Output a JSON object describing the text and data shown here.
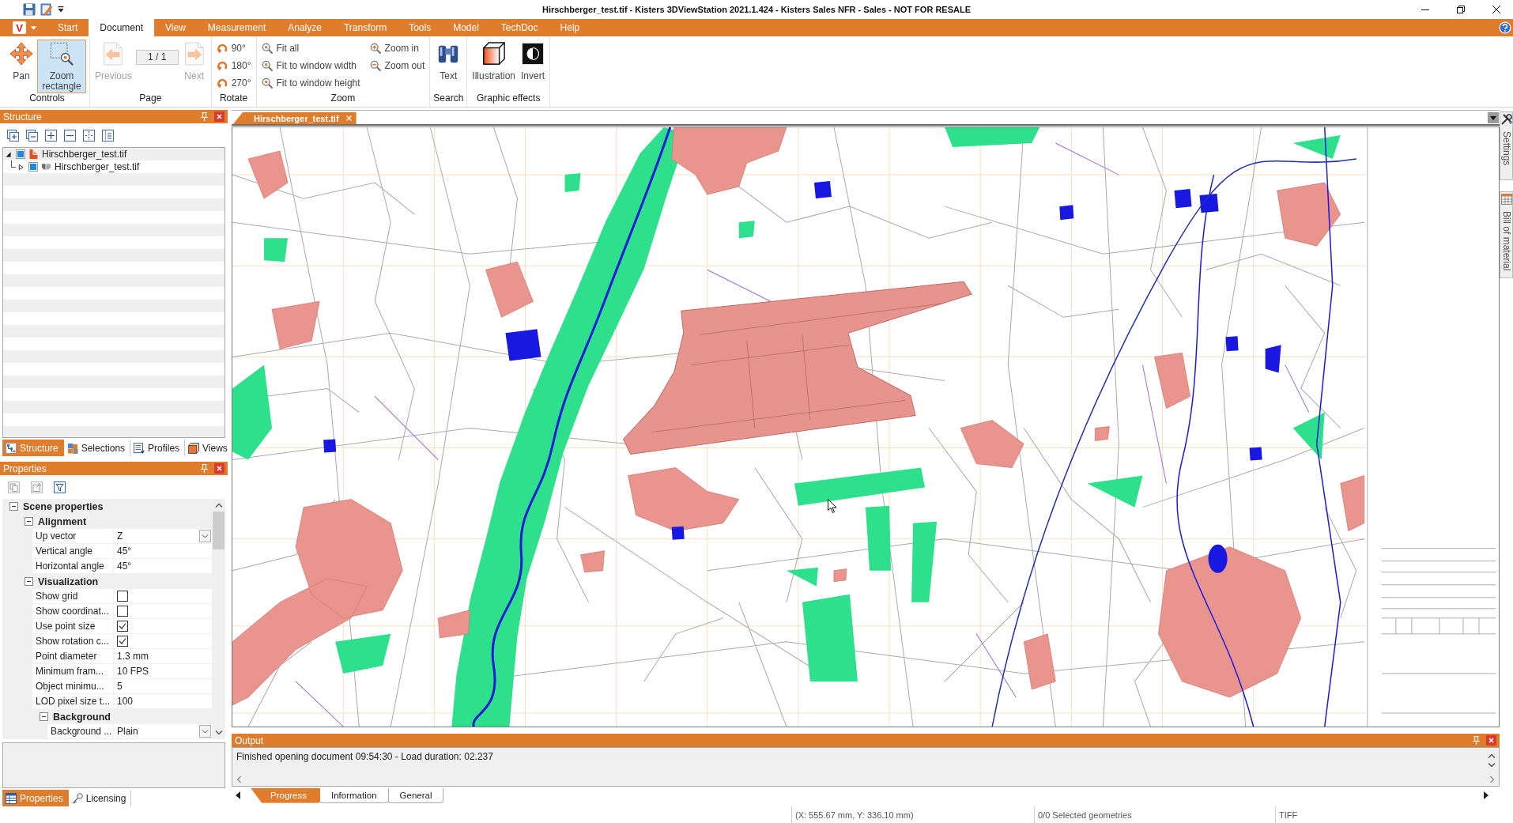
{
  "window": {
    "title": "Hirschberger_test.tif - Kisters 3DViewStation 2021.1.424 - Kisters Sales NFR - Sales - NOT FOR RESALE"
  },
  "app_button": {
    "label": "V"
  },
  "ribbon_tabs": [
    {
      "label": "Start",
      "selected": false
    },
    {
      "label": "Document",
      "selected": true
    },
    {
      "label": "View",
      "selected": false
    },
    {
      "label": "Measurement",
      "selected": false
    },
    {
      "label": "Analyze",
      "selected": false
    },
    {
      "label": "Transform",
      "selected": false
    },
    {
      "label": "Tools",
      "selected": false
    },
    {
      "label": "Model",
      "selected": false
    },
    {
      "label": "TechDoc",
      "selected": false
    },
    {
      "label": "Help",
      "selected": false
    }
  ],
  "ribbon_groups": [
    {
      "label": "Controls",
      "items": [
        {
          "kind": "large",
          "label": "Pan",
          "selected": false,
          "disabled": false
        },
        {
          "kind": "large",
          "label": "Zoom rectangle",
          "selected": true,
          "disabled": false
        }
      ]
    },
    {
      "label": "Page",
      "items": [
        {
          "kind": "large",
          "label": "Previous",
          "selected": false,
          "disabled": true
        },
        {
          "kind": "page_field",
          "value": "1 / 1"
        },
        {
          "kind": "large",
          "label": "Next",
          "selected": false,
          "disabled": true
        }
      ]
    },
    {
      "label": "Rotate",
      "items": [
        {
          "kind": "small",
          "label": "90°"
        },
        {
          "kind": "small",
          "label": "180°"
        },
        {
          "kind": "small",
          "label": "270°"
        }
      ]
    },
    {
      "label": "Zoom",
      "items": [
        {
          "kind": "small",
          "label": "Fit all"
        },
        {
          "kind": "small",
          "label": "Fit to window width"
        },
        {
          "kind": "small",
          "label": "Fit to window height"
        },
        {
          "kind": "small",
          "label": "Zoom in"
        },
        {
          "kind": "small",
          "label": "Zoom out"
        }
      ]
    },
    {
      "label": "Search",
      "items": [
        {
          "kind": "large",
          "label": "Text",
          "selected": false,
          "disabled": false
        }
      ]
    },
    {
      "label": "Graphic effects",
      "items": [
        {
          "kind": "large",
          "label": "Illustration",
          "selected": false,
          "disabled": false
        },
        {
          "kind": "large",
          "label": "Invert",
          "selected": false,
          "disabled": false
        }
      ]
    }
  ],
  "structure_panel": {
    "title": "Structure",
    "tree": [
      {
        "label": "Hirschberger_test.tif",
        "checked": true,
        "expanded": true,
        "children": [
          {
            "label": "Hirschberger_test.tif",
            "checked": true,
            "expanded": false
          }
        ]
      }
    ],
    "tabs": [
      {
        "label": "Structure",
        "selected": true
      },
      {
        "label": "Selections",
        "selected": false
      },
      {
        "label": "Profiles",
        "selected": false
      },
      {
        "label": "Views",
        "selected": false
      }
    ]
  },
  "properties_panel": {
    "title": "Properties",
    "grid": [
      {
        "kind": "group",
        "label": "Scene properties",
        "expanded": true,
        "children": [
          {
            "kind": "group",
            "label": "Alignment",
            "expanded": true,
            "children": [
              {
                "kind": "dropdown",
                "name": "Up vector",
                "value": "Z"
              },
              {
                "kind": "text",
                "name": "Vertical angle",
                "value": "45°"
              },
              {
                "kind": "text",
                "name": "Horizontal angle",
                "value": "45°"
              }
            ]
          },
          {
            "kind": "group",
            "label": "Visualization",
            "expanded": true,
            "children": [
              {
                "kind": "checkbox",
                "name": "Show grid",
                "checked": false
              },
              {
                "kind": "checkbox",
                "name": "Show coordinat...",
                "checked": false
              },
              {
                "kind": "checkbox",
                "name": "Use point size",
                "checked": true
              },
              {
                "kind": "checkbox",
                "name": "Show rotation c...",
                "checked": true
              },
              {
                "kind": "text",
                "name": "Point diameter",
                "value": "1.3 mm"
              },
              {
                "kind": "text",
                "name": "Minimum fram...",
                "value": "10 FPS"
              },
              {
                "kind": "text",
                "name": "Object minimu...",
                "value": "5"
              },
              {
                "kind": "text",
                "name": "LOD pixel size t...",
                "value": "100"
              },
              {
                "kind": "group",
                "label": "Background",
                "expanded": true,
                "children": [
                  {
                    "kind": "dropdown",
                    "name": "Background ...",
                    "value": "Plain"
                  }
                ]
              }
            ]
          }
        ]
      }
    ],
    "tabs": [
      {
        "label": "Properties",
        "selected": true
      },
      {
        "label": "Licensing",
        "selected": false
      }
    ]
  },
  "document_tabs": [
    {
      "label": "Hirschberger_test.tif",
      "selected": true
    }
  ],
  "side_tabs": [
    {
      "label": "Settings"
    },
    {
      "label": "Bill of material"
    }
  ],
  "output_panel": {
    "title": "Output",
    "message": "Finished opening document 09:54:30 - Load duration: 02.237",
    "tabs": [
      {
        "label": "Progress",
        "selected": true
      },
      {
        "label": "Information",
        "selected": false
      },
      {
        "label": "General",
        "selected": false
      }
    ]
  },
  "status_bar": {
    "coordinates": "(X: 555.67 mm, Y: 336.10 mm)",
    "selection": "0/0 Selected geometries",
    "format": "TIFF"
  }
}
